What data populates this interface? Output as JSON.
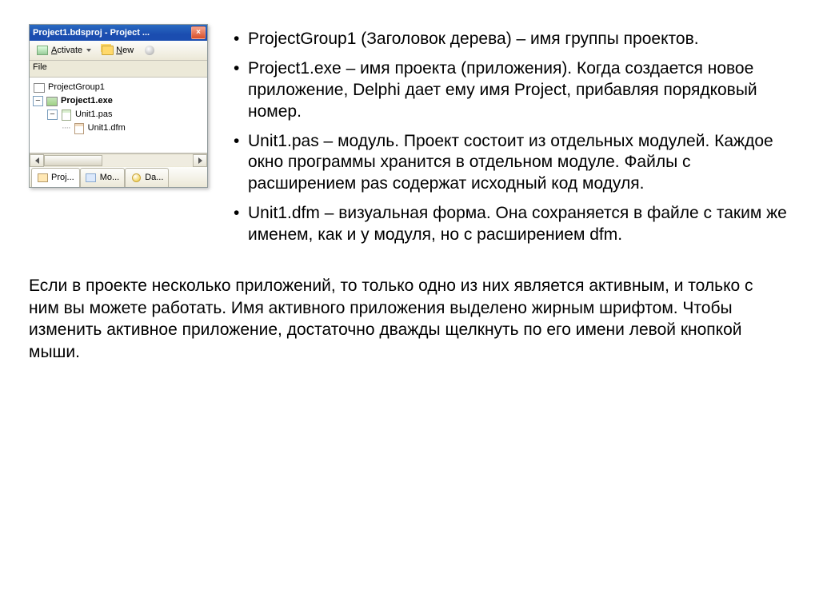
{
  "panel": {
    "title": "Project1.bdsproj - Project ...",
    "close": "×",
    "toolbar": {
      "activate": "Activate",
      "new": "New"
    },
    "file_label": "File",
    "tree": {
      "root": "ProjectGroup1",
      "exe": "Project1.exe",
      "pas": "Unit1.pas",
      "dfm": "Unit1.dfm"
    },
    "tabs": {
      "t1": "Proj...",
      "t2": "Mo...",
      "t3": "Da..."
    }
  },
  "bullets": {
    "b1": "ProjectGroup1 (Заголовок дерева) – имя группы проектов.",
    "b2": "Project1.exe – имя проекта (приложения). Когда создается новое приложение, Delphi дает ему имя Project, прибавляя порядковый номер.",
    "b3": "Unit1.pas – модуль. Проект состоит из отдельных модулей. Каждое окно программы хранится в отдельном модуле. Файлы с расширением pas содержат исходный код модуля.",
    "b4": "Unit1.dfm – визуальная форма. Она сохраняется в файле с таким же именем, как и у модуля, но с расширением dfm."
  },
  "bottom": "Если в проекте несколько приложений, то только одно из них является активным, и только с ним вы можете работать. Имя активного приложения выделено жирным шрифтом. Чтобы изменить активное приложение, достаточно дважды щелкнуть по его имени левой кнопкой мыши."
}
